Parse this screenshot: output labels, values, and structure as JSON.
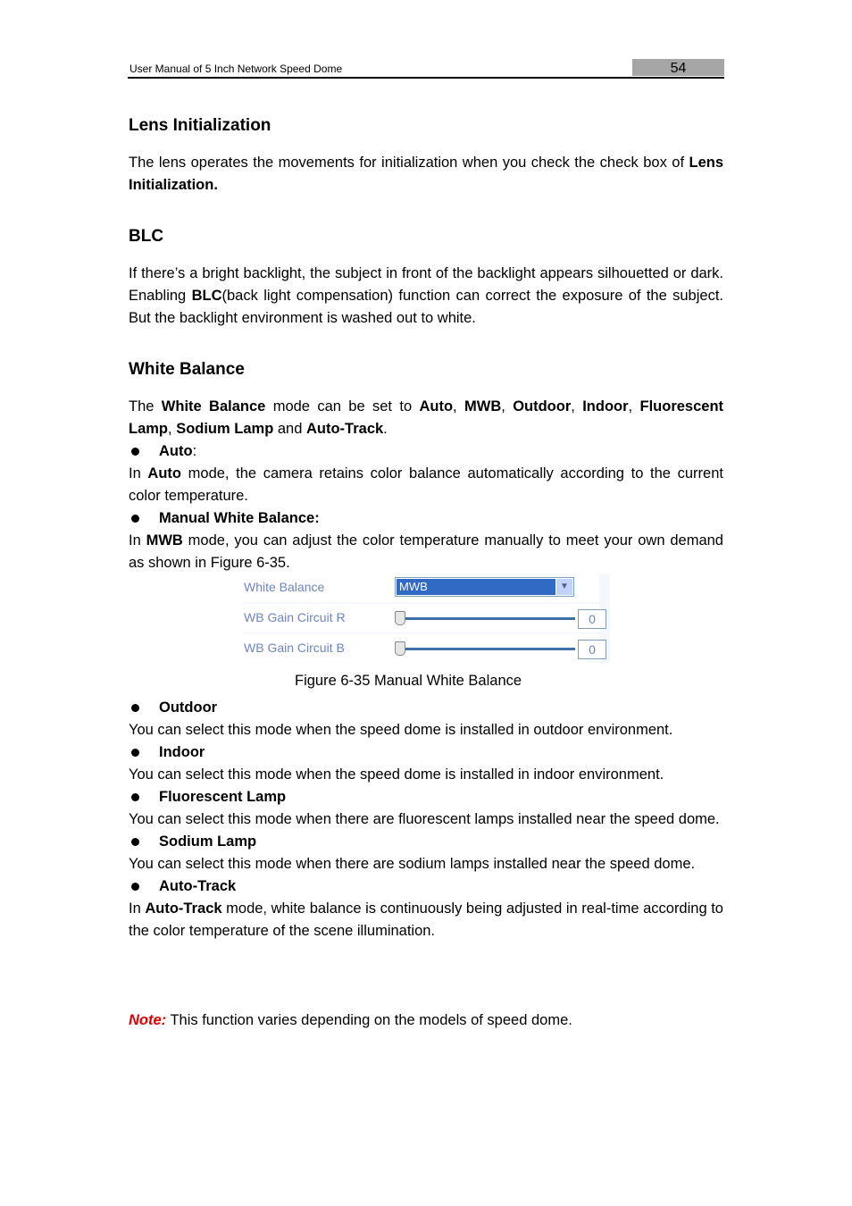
{
  "header": {
    "title": "User Manual of 5 Inch Network Speed Dome",
    "page_number": "54"
  },
  "sections": {
    "lens_init": {
      "heading": "Lens Initialization",
      "text": "The lens operates the movements for initialization when you check the check box of ",
      "bold": "Lens Initialization."
    },
    "blc": {
      "heading": "BLC",
      "text1": "If there’s a bright backlight, the subject in front of the backlight appears silhouetted or dark. Enabling ",
      "bold": "BLC",
      "text2": "(back light compensation) function can correct the exposure of the subject. But the backlight environment is washed out to white."
    },
    "white_balance": {
      "heading": "White Balance",
      "intro": {
        "t1": "The ",
        "b1": "White Balance",
        "t2": " mode can be set to ",
        "b2": "Auto",
        "b3": "MWB",
        "b4": "Outdoor",
        "b5": "Indoor",
        "b6": "Fluorescent Lamp",
        "b7": "Sodium Lamp",
        "t3": " and ",
        "b8": "Auto-Track",
        "sep": ", ",
        "end": "."
      },
      "auto": {
        "bullet": "Auto",
        "colon": ":",
        "t1": "In ",
        "b": "Auto",
        "t2": " mode, the camera retains color balance automatically according to the current color temperature."
      },
      "mwb": {
        "bullet": "Manual White Balance:",
        "t1": "In ",
        "b": "MWB",
        "t2": " mode, you can adjust the color temperature manually to meet your own demand as shown in Figure 6-35."
      },
      "outdoor": {
        "bullet": "Outdoor",
        "text": "You can select this mode when the speed dome is installed in outdoor environment."
      },
      "indoor": {
        "bullet": "Indoor",
        "text": "You can select this mode when the speed dome is installed in indoor environment."
      },
      "fluorescent": {
        "bullet": "Fluorescent Lamp",
        "text": "You can select this mode when there are fluorescent lamps installed near the speed dome."
      },
      "sodium": {
        "bullet": "Sodium Lamp",
        "text": "You can select this mode when there are sodium lamps installed near the speed dome."
      },
      "autotrack": {
        "bullet": "Auto-Track",
        "t1": "In ",
        "b": "Auto-Track",
        "t2": " mode, white balance is continuously being adjusted in real-time according to the color temperature of the scene illumination."
      }
    },
    "note": {
      "label": "Note:",
      "text": " This function varies depending on the models of speed dome."
    }
  },
  "figure": {
    "rows": [
      {
        "label": "White Balance",
        "value": "MWB"
      },
      {
        "label": "WB Gain Circuit R",
        "value": "0",
        "slider_fraction": 0
      },
      {
        "label": "WB Gain Circuit B",
        "value": "0",
        "slider_fraction": 0
      }
    ],
    "caption": "Figure 6-35 Manual White Balance"
  }
}
